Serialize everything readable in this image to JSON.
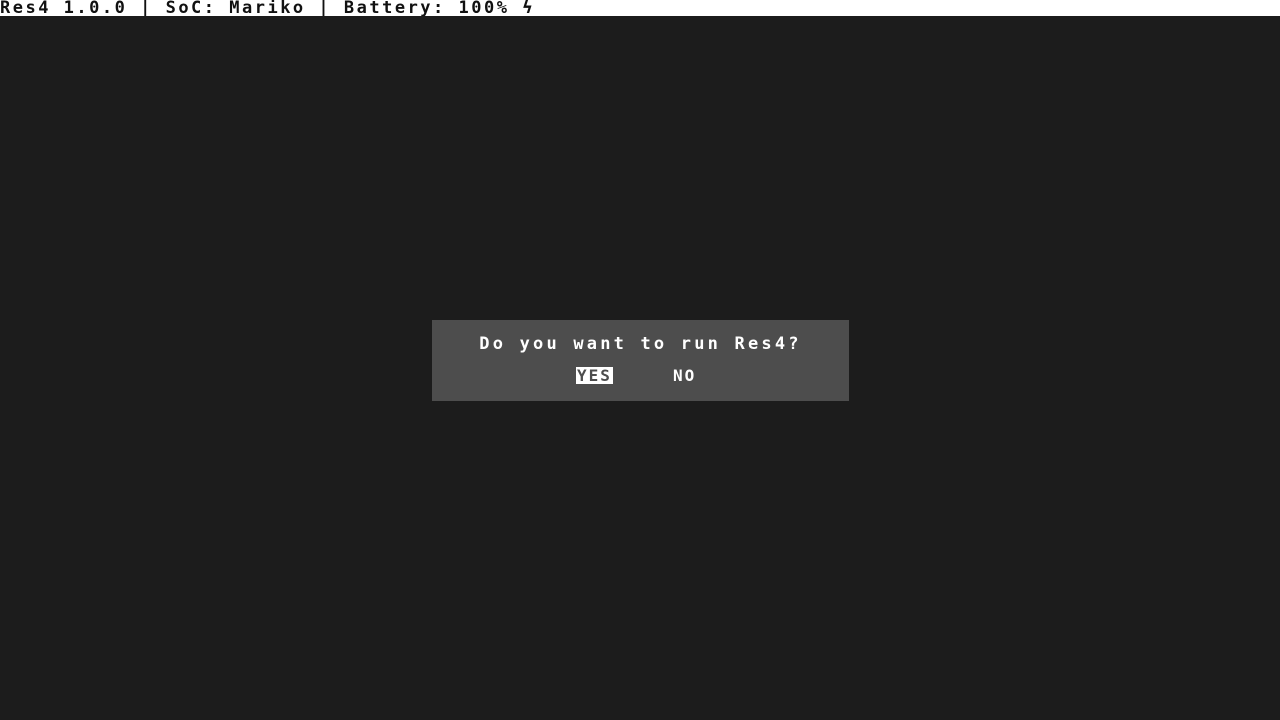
{
  "status_bar": {
    "app_version": "Res4 1.0.0",
    "separator_1": " | ",
    "soc": "SoC: Mariko",
    "separator_2": " | ",
    "battery": "Battery: 100%",
    "charging_icon_glyph": "ϟ",
    "charging_icon": "lightning-bolt-icon"
  },
  "dialog": {
    "question": "Do you want to run Res4?",
    "yes_label": "YES",
    "no_label": "NO",
    "selected_option": "YES"
  },
  "colors": {
    "background": "#1c1c1c",
    "status_bar_bg": "#ffffff",
    "dialog_bg": "#4d4d4d",
    "text": "#ffffff",
    "selection_bg": "#ffffff"
  }
}
